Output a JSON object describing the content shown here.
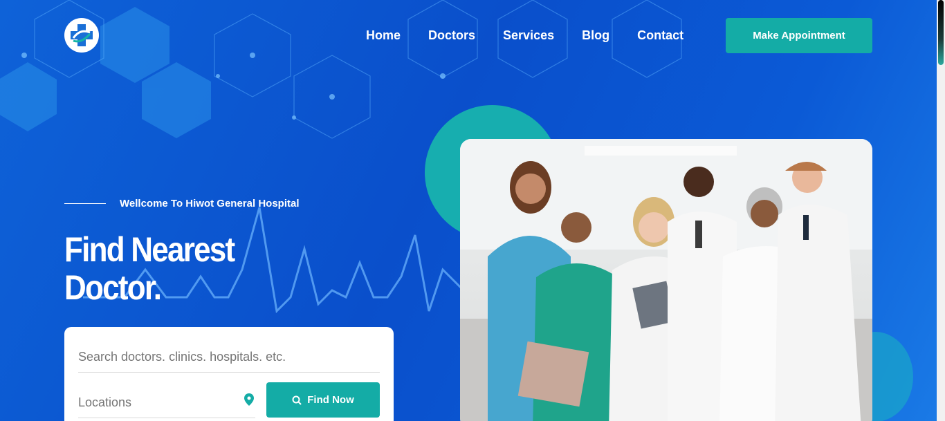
{
  "nav": {
    "items": [
      "Home",
      "Doctors",
      "Services",
      "Blog",
      "Contact"
    ],
    "cta_label": "Make Appointment"
  },
  "hero": {
    "welcome": "Wellcome To Hiwot General Hospital",
    "title_line1": "Find Nearest",
    "title_line2": "Doctor."
  },
  "search": {
    "query_placeholder": "Search doctors. clinics. hospitals. etc.",
    "location_placeholder": "Locations",
    "button_label": "Find Now"
  },
  "colors": {
    "background": "#0a4fc9",
    "accent": "#14aca6",
    "text_on_dark": "#ffffff"
  }
}
